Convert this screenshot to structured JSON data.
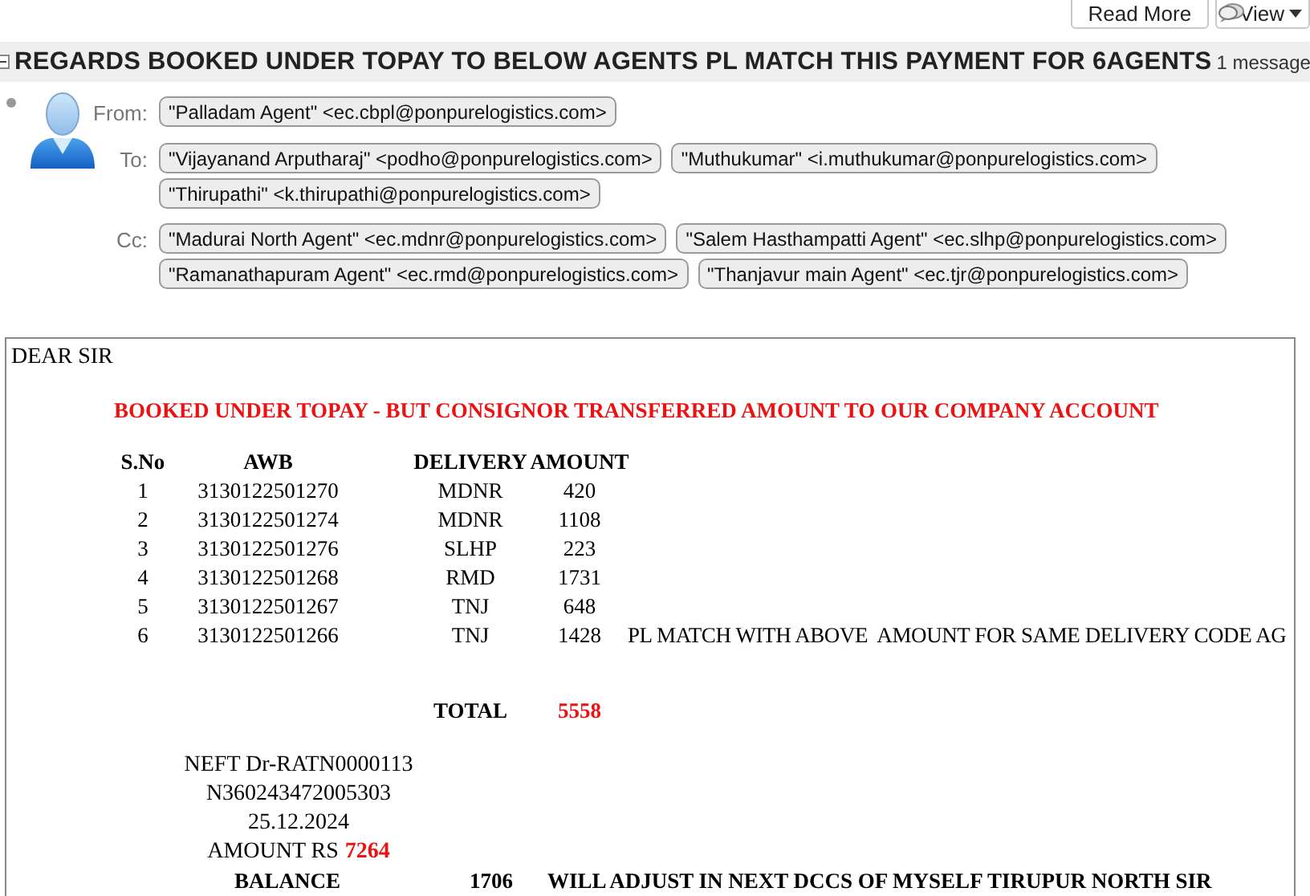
{
  "toolbar": {
    "buttons": [
      {
        "label": "Read More",
        "kind": "plain"
      },
      {
        "label": "View",
        "kind": "menu"
      }
    ]
  },
  "subject": {
    "text": "REGARDS BOOKED UNDER TOPAY TO BELOW AGENTS PL MATCH THIS PAYMENT FOR 6AGENTS",
    "count": "1 message",
    "expanded": true
  },
  "headers": [
    {
      "label": "From:",
      "lines": [
        [
          "\"Palladam Agent\" <ec.cbpl@ponpurelogistics.com>"
        ]
      ]
    },
    {
      "label": "To:",
      "lines": [
        [
          "\"Vijayanand Arputharaj\" <podho@ponpurelogistics.com>",
          "\"Muthukumar\" <i.muthukumar@ponpurelogistics.com>"
        ],
        [
          "\"Thirupathi\" <k.thirupathi@ponpurelogistics.com>"
        ]
      ]
    },
    {
      "label": "Cc:",
      "lines": [
        [
          "\"Madurai North Agent\" <ec.mdnr@ponpurelogistics.com>",
          "\"Salem Hasthampatti Agent\" <ec.slhp@ponpurelogistics.com>"
        ],
        [
          "\"Ramanathapuram Agent\" <ec.rmd@ponpurelogistics.com>",
          "\"Thanjavur main Agent\" <ec.tjr@ponpurelogistics.com>"
        ]
      ]
    }
  ],
  "body": {
    "greeting": "DEAR SIR",
    "heading": "BOOKED UNDER TOPAY - BUT CONSIGNOR TRANSFERRED AMOUNT TO OUR COMPANY ACCOUNT",
    "columns": [
      "S.No",
      "AWB",
      "DELIVERY",
      "AMOUNT"
    ],
    "rows": [
      {
        "sno": "1",
        "awb": "3130122501270",
        "delivery": "MDNR",
        "amount": "420"
      },
      {
        "sno": "2",
        "awb": "3130122501274",
        "delivery": "MDNR",
        "amount": "1108"
      },
      {
        "sno": "3",
        "awb": "3130122501276",
        "delivery": "SLHP",
        "amount": "223"
      },
      {
        "sno": "4",
        "awb": "3130122501268",
        "delivery": "RMD",
        "amount": "1731"
      },
      {
        "sno": "5",
        "awb": "3130122501267",
        "delivery": "TNJ",
        "amount": "648"
      },
      {
        "sno": "6",
        "awb": "3130122501266",
        "delivery": "TNJ",
        "amount": "1428",
        "note": "PL MATCH WITH ABOVE  AMOUNT FOR SAME DELIVERY CODE AG"
      }
    ],
    "total": {
      "label": "TOTAL",
      "value": "5558"
    },
    "payment_lines": [
      "NEFT Dr-RATN0000113",
      "N360243472005303",
      "25.12.2024"
    ],
    "amount": {
      "label": "AMOUNT RS",
      "value": "7264"
    },
    "balance": {
      "label": "BALANCE",
      "value": "1706",
      "note": "WILL ADJUST IN NEXT DCCS OF MYSELF TIRUPUR NORTH SIR"
    }
  }
}
